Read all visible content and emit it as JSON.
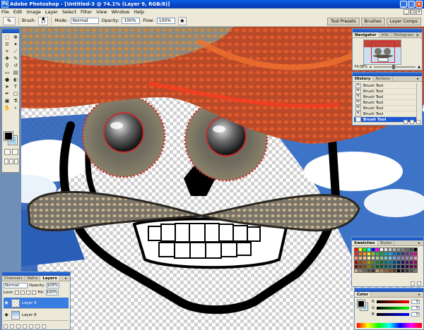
{
  "title_bar": {
    "title": "Adobe Photoshop - [Untitled-3 @ 74.1% (Layer 9, RGB/8)]",
    "controls": [
      "_",
      "□",
      "×"
    ]
  },
  "menu": [
    "File",
    "Edit",
    "Image",
    "Layer",
    "Select",
    "Filter",
    "View",
    "Window",
    "Help"
  ],
  "options_bar": {
    "brush_label": "Brush:",
    "brush_size": "17",
    "mode_label": "Mode:",
    "mode_value": "Normal",
    "opacity_label": "Opacity:",
    "opacity_value": "100%",
    "flow_label": "Flow:",
    "flow_value": "100%"
  },
  "palette_well": [
    "Tool Presets",
    "Brushes",
    "Layer Comps"
  ],
  "navigator": {
    "tabs": [
      "Navigator",
      "Info",
      "Histogram"
    ],
    "zoom": "74.08%"
  },
  "history": {
    "tabs": [
      "History",
      "Actions"
    ],
    "items": [
      "Brush Tool",
      "Brush Tool",
      "Brush Tool",
      "Brush Tool",
      "Brush Tool",
      "Brush Tool",
      "Brush Tool"
    ],
    "active_index": 6
  },
  "swatches": {
    "tabs": [
      "Swatches",
      "Styles"
    ],
    "colors": [
      "#ff0000",
      "#ffff00",
      "#00ff00",
      "#00ffff",
      "#0000ff",
      "#ff00ff",
      "#ffffff",
      "#e6e6e6",
      "#cccccc",
      "#b3b3b3",
      "#999999",
      "#808080",
      "#666666",
      "#4d4d4d",
      "#000000",
      "#ed1c24",
      "#f26522",
      "#f7941d",
      "#fff200",
      "#8dc63f",
      "#39b54a",
      "#00a651",
      "#00a99d",
      "#00aeef",
      "#0072bc",
      "#0054a6",
      "#2e3192",
      "#662d91",
      "#92278f",
      "#ec008c",
      "#f7977a",
      "#f9ad81",
      "#fdc68a",
      "#fff79a",
      "#c4df9b",
      "#a3d39c",
      "#82ca9d",
      "#7bcdc8",
      "#6ecff6",
      "#7ea7d8",
      "#8493ca",
      "#8882be",
      "#a187be",
      "#bc8dbf",
      "#f49ac2",
      "#9e0b0f",
      "#a0410d",
      "#a36209",
      "#aba000",
      "#598527",
      "#197b30",
      "#007236",
      "#00746b",
      "#0076a3",
      "#004b80",
      "#003471",
      "#1b1464",
      "#440e62",
      "#630460",
      "#9e005d",
      "#790000",
      "#7b2e00",
      "#7d4900",
      "#827b00",
      "#406618",
      "#005e20",
      "#005826",
      "#005952",
      "#005b7f",
      "#003663",
      "#002157",
      "#0d004c",
      "#32004b",
      "#4b0049",
      "#7b0046",
      "#c7b299",
      "#998675",
      "#736357",
      "#534741",
      "#37302d",
      "#c69c6d",
      "#a67c52",
      "#8c6239",
      "#754c24",
      "#603913",
      "#000000",
      "#1a1a1a",
      "#333333",
      "#555555",
      "#777777"
    ]
  },
  "color_panel": {
    "tab": "Color",
    "channels": [
      {
        "label": "R",
        "value": "0"
      },
      {
        "label": "G",
        "value": "0"
      },
      {
        "label": "B",
        "value": "0"
      }
    ]
  },
  "layers": {
    "tabs": [
      "Channels",
      "Paths",
      "Layers"
    ],
    "blend_mode": "Normal",
    "opacity_label": "Opacity:",
    "opacity_value": "100%",
    "lock_label": "Lock:",
    "fill_label": "Fill:",
    "fill_value": "100%",
    "items": [
      {
        "name": "Layer 9",
        "active": true
      },
      {
        "name": "Layer 8",
        "active": false
      }
    ]
  },
  "colors": {
    "foreground": "#000000",
    "background": "#9fd2e8",
    "accent": "#1c56d0"
  }
}
